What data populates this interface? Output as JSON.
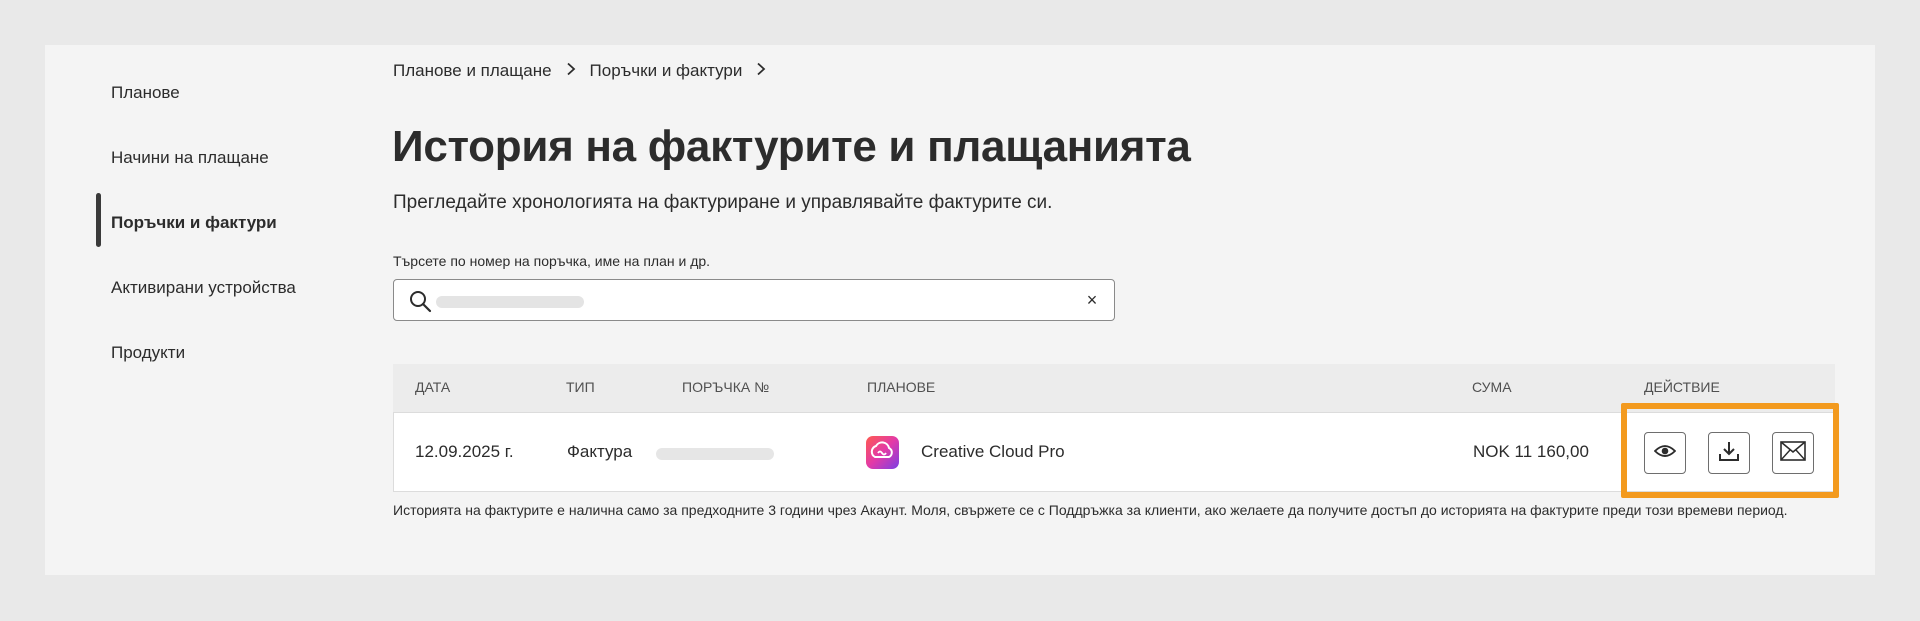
{
  "sidebar": {
    "items": [
      {
        "label": "Планове"
      },
      {
        "label": "Начини на плащане"
      },
      {
        "label": "Поръчки и фактури"
      },
      {
        "label": "Активирани устройства"
      },
      {
        "label": "Продукти"
      }
    ],
    "active_index": 2
  },
  "breadcrumb": {
    "items": [
      "Планове и плащане",
      "Поръчки и фактури"
    ],
    "separator": ">"
  },
  "page": {
    "title": "История на фактурите и плащанията",
    "subtitle": "Прегледайте хронологията на фактуриране и управлявайте фактурите си."
  },
  "search": {
    "label": "Търсете по номер на поръчка, име на план и др.",
    "value": "",
    "clear_symbol": "×"
  },
  "table": {
    "columns": [
      "ДАТА",
      "ТИП",
      "ПОРЪЧКА №",
      "ПЛАНОВЕ",
      "СУМА",
      "ДЕЙСТВИЕ"
    ],
    "rows": [
      {
        "date": "12.09.2025 г.",
        "type": "Фактура",
        "order_no": "",
        "plan": "Creative Cloud Pro",
        "amount": "NOK 11 160,00",
        "actions": [
          "view-icon",
          "download-icon",
          "email-icon"
        ]
      }
    ]
  },
  "footnote": "Историята на фактурите е налична само за предходните 3 години чрез Акаунт. Моля, свържете се с Поддръжка за клиенти, ако желаете да получите достъп до историята на фактурите преди този времеви период.",
  "colors": {
    "highlight": "#f39a1e",
    "background": "#e9e9e9",
    "panel": "#f4f4f4"
  }
}
